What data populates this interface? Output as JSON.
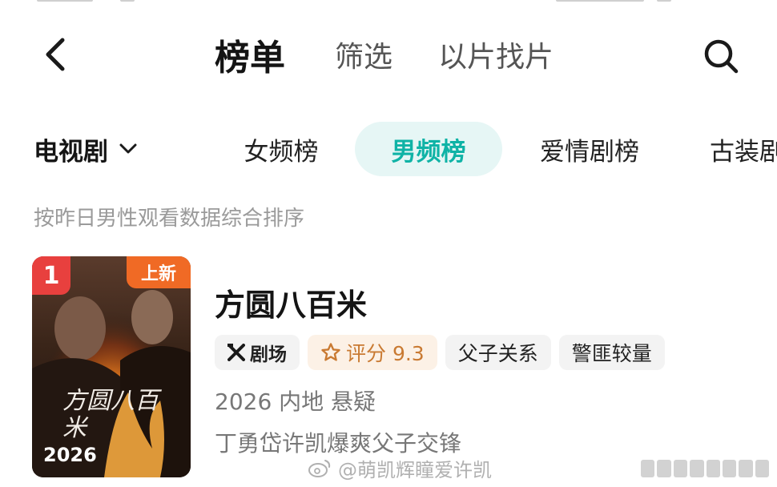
{
  "nav": {
    "tabs": [
      {
        "label": "榜单",
        "active": true
      },
      {
        "label": "筛选",
        "active": false
      },
      {
        "label": "以片找片",
        "active": false
      }
    ],
    "back_icon": "chevron-left-icon",
    "search_icon": "search-icon"
  },
  "category": {
    "selected": "电视剧",
    "dropdown_icon": "chevron-down-icon"
  },
  "rank_tabs": [
    {
      "label": "女频榜",
      "active": false
    },
    {
      "label": "男频榜",
      "active": true
    },
    {
      "label": "爱情剧榜",
      "active": false
    },
    {
      "label": "古装剧",
      "active": false
    }
  ],
  "subtitle": "按昨日男性观看数据综合排序",
  "items": [
    {
      "rank": "1",
      "badge": "上新",
      "poster_year": "2026",
      "poster_title_art": "方圆八百米",
      "title": "方圆八百米",
      "platform_tag": "剧场",
      "rating_label": "评分 9.3",
      "rating_value": 9.3,
      "tags": [
        "父子关系",
        "警匪较量"
      ],
      "meta": "2026 内地 悬疑",
      "description": "丁勇岱许凯爆爽父子交锋"
    }
  ],
  "watermark": "@萌凯辉瞳爱许凯",
  "colors": {
    "accent": "#0fb3a6",
    "accent_bg": "#e6f6f5",
    "rank_red": "#e8403e",
    "new_orange": "#f06a25",
    "rating": "#c97a32"
  }
}
